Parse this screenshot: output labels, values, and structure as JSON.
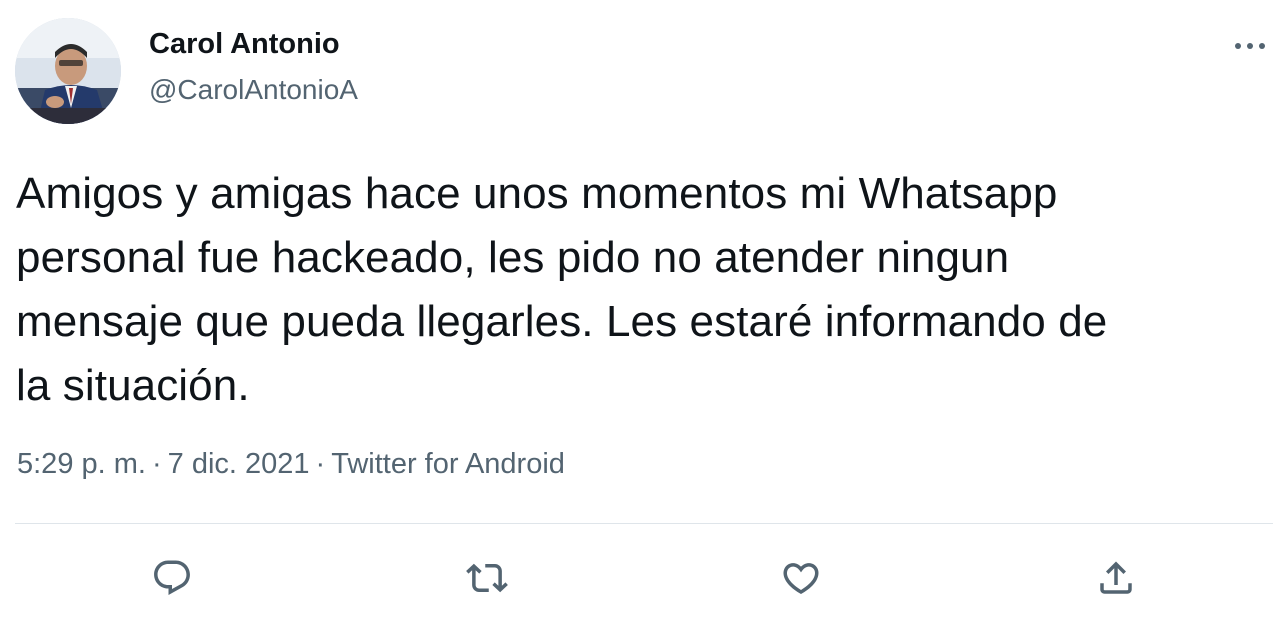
{
  "author": {
    "display_name": "Carol Antonio",
    "handle": "@CarolAntonioA"
  },
  "tweet": {
    "text_lines": [
      "Amigos y amigas hace unos momentos mi Whatsapp",
      "personal fue hackeado, les pido no atender ningun",
      "mensaje que pueda llegarles. Les estaré informando de",
      "la situación."
    ],
    "time": "5:29 p. m.",
    "date": "7 dic. 2021",
    "source": "Twitter for Android",
    "separator": "·"
  },
  "actions": [
    {
      "icon": "reply-icon"
    },
    {
      "icon": "retweet-icon"
    },
    {
      "icon": "like-icon"
    },
    {
      "icon": "share-icon"
    }
  ],
  "colors": {
    "text_primary": "#0f1419",
    "text_secondary": "#536471",
    "divider": "#dfe5ea"
  }
}
